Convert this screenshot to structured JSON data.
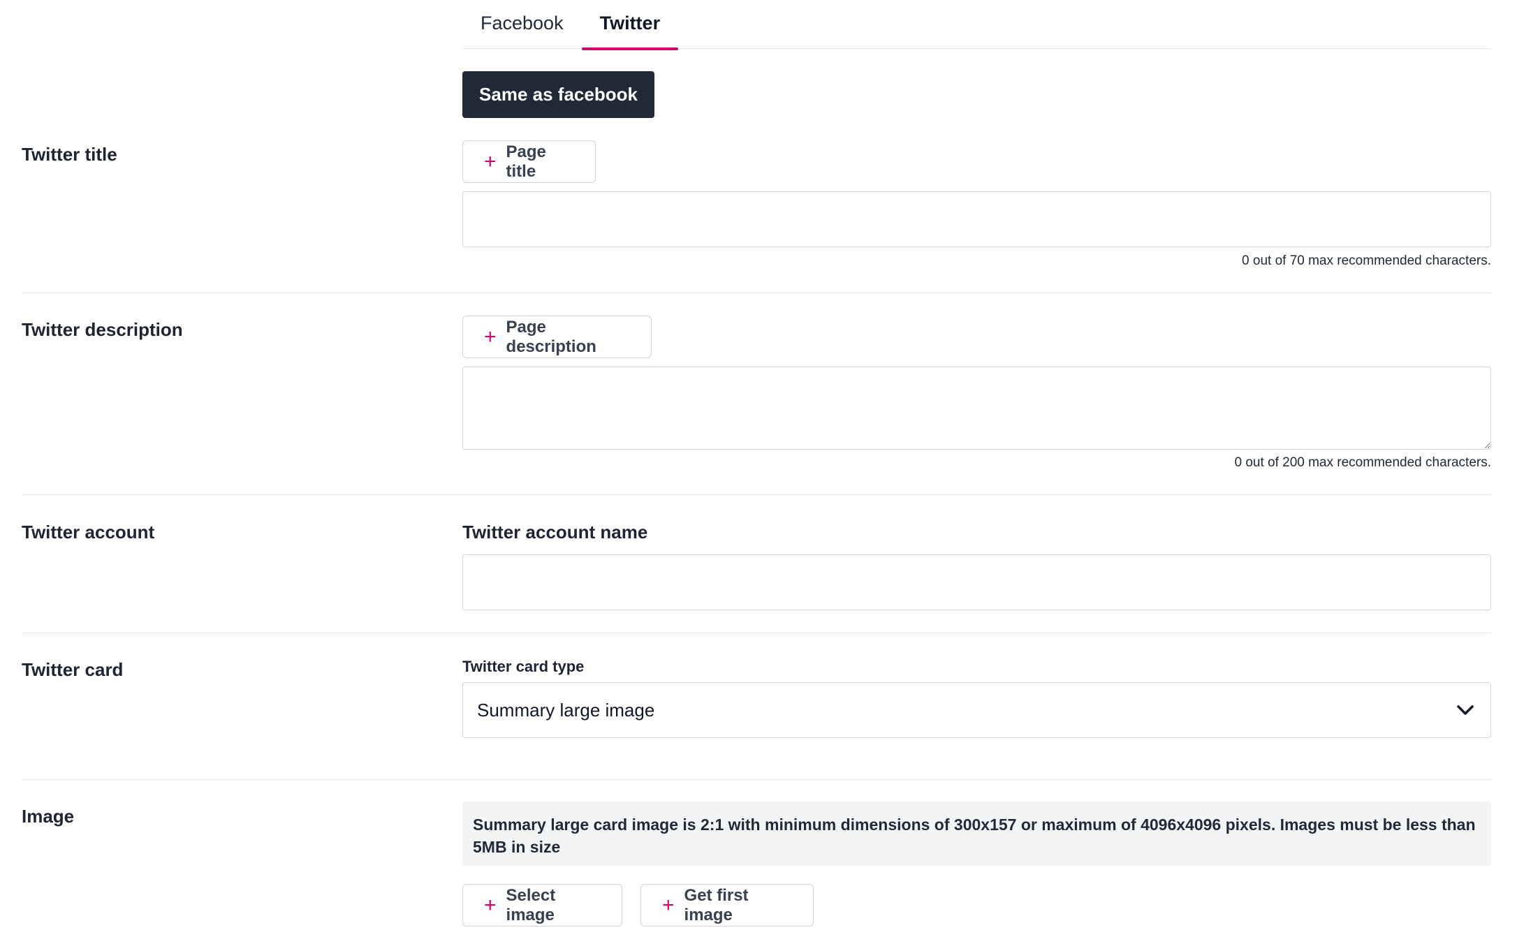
{
  "tabs": [
    {
      "label": "Facebook",
      "active": false
    },
    {
      "label": "Twitter",
      "active": true
    }
  ],
  "same_as_facebook_label": "Same as facebook",
  "twitter_title": {
    "label": "Twitter title",
    "insert_button": "Page title",
    "value": "",
    "counter": "0 out of 70 max recommended characters."
  },
  "twitter_description": {
    "label": "Twitter description",
    "insert_button": "Page description",
    "value": "",
    "counter": "0 out of 200 max recommended characters."
  },
  "twitter_account": {
    "label": "Twitter account",
    "field_label": "Twitter account name",
    "value": ""
  },
  "twitter_card": {
    "label": "Twitter card",
    "field_label": "Twitter card type",
    "selected": "Summary large image"
  },
  "image": {
    "label": "Image",
    "info": "Summary large card image is 2:1 with minimum dimensions of 300x157 or maximum of 4096x4096 pixels. Images must be less than 5MB in size",
    "select_button": "Select image",
    "first_image_button": "Get first image"
  },
  "colors": {
    "accent": "#d6006f",
    "dark_button": "#1f2937"
  }
}
